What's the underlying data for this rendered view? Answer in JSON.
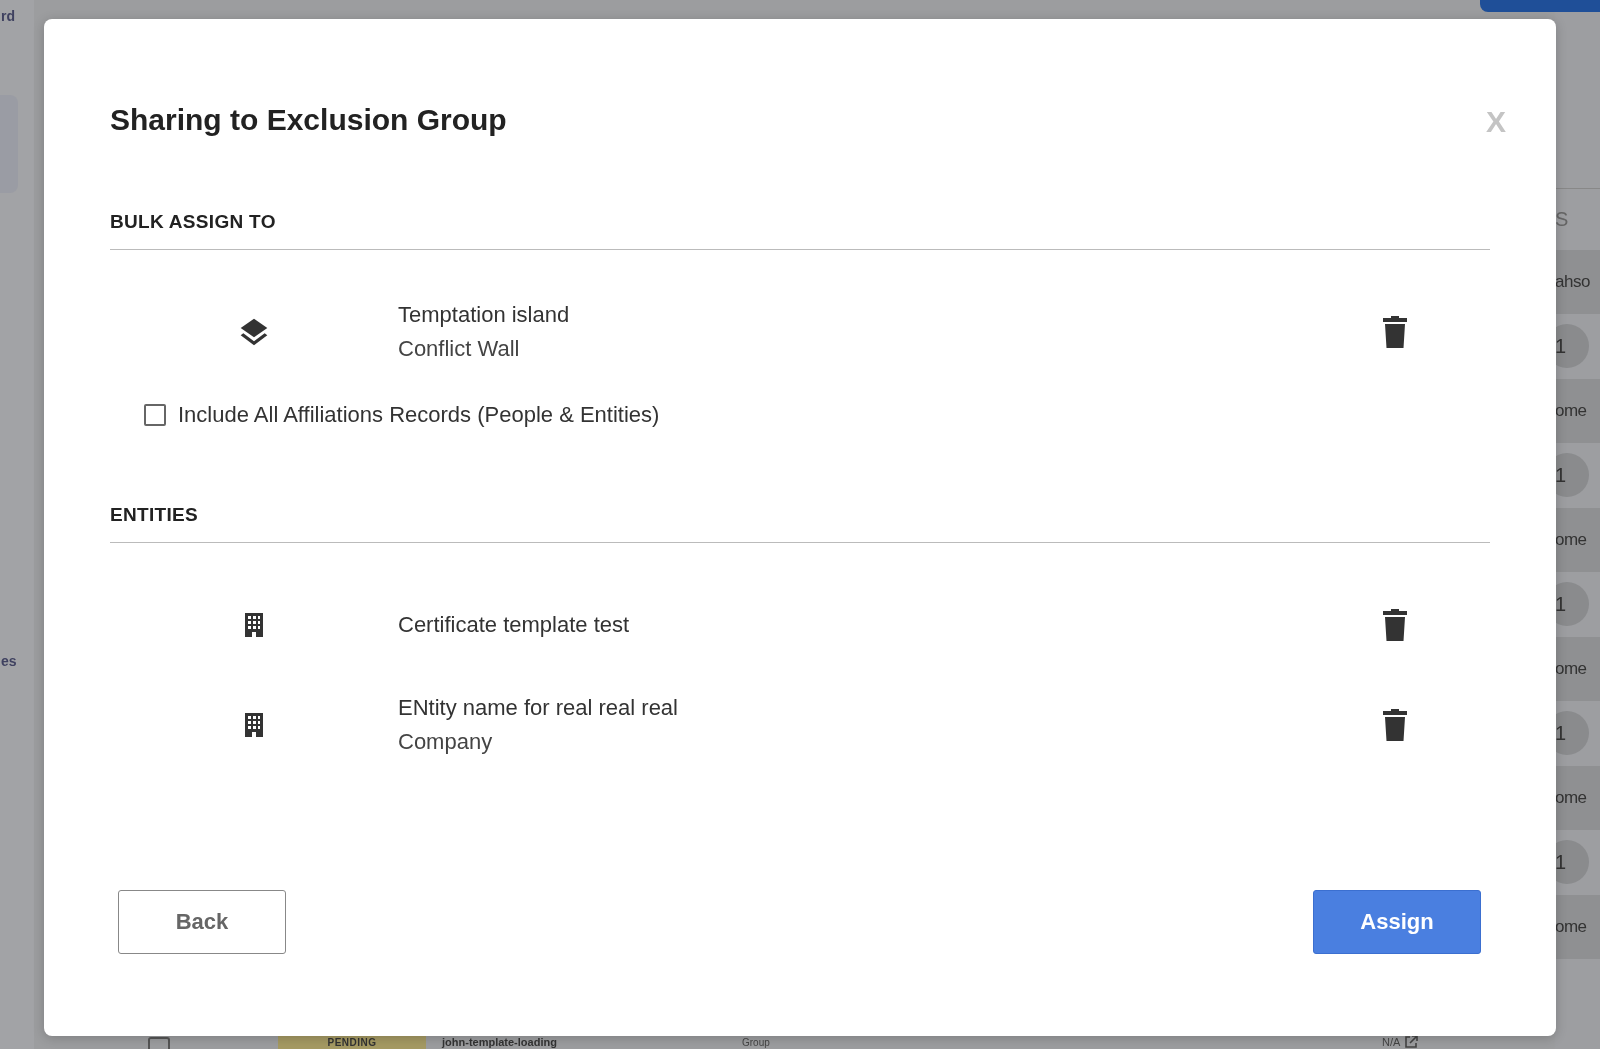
{
  "background": {
    "sidebar_texts": [
      "rd",
      "es"
    ],
    "right_header": "S",
    "right_cells": [
      {
        "kind": "text",
        "text": "ahso"
      },
      {
        "kind": "circle",
        "text": "1"
      },
      {
        "kind": "text",
        "text": "ome"
      },
      {
        "kind": "circle",
        "text": "1"
      },
      {
        "kind": "text",
        "text": "ome"
      },
      {
        "kind": "circle",
        "text": "1"
      },
      {
        "kind": "text",
        "text": "ome"
      },
      {
        "kind": "circle",
        "text": "1"
      },
      {
        "kind": "text",
        "text": "ome"
      },
      {
        "kind": "circle",
        "text": "1"
      },
      {
        "kind": "text",
        "text": "ome"
      }
    ],
    "bottom_row": {
      "checked": false,
      "status": "PENDING",
      "name": "john-template-loading",
      "type": "Group",
      "link": "N/A"
    }
  },
  "modal": {
    "title": "Sharing to Exclusion Group",
    "close": "X",
    "sections": [
      {
        "heading": "BULK ASSIGN TO",
        "items": [
          {
            "kind": "layers",
            "title": "Temptation island",
            "subtitle": "Conflict Wall"
          }
        ],
        "option": {
          "label": "Include All Affiliations Records (People & Entities)",
          "checked": false
        }
      },
      {
        "heading": "ENTITIES",
        "items": [
          {
            "kind": "building",
            "title": "Certificate template test"
          },
          {
            "kind": "building",
            "title": "ENtity name for real real real",
            "subtitle": "Company"
          }
        ]
      }
    ],
    "buttons": [
      {
        "kind": "secondary",
        "label": "Back"
      },
      {
        "kind": "primary",
        "label": "Assign"
      }
    ]
  }
}
